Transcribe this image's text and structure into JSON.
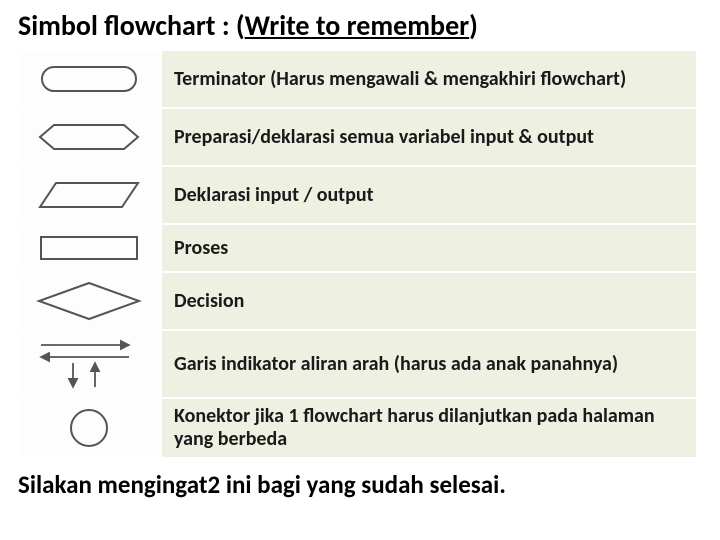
{
  "title_main": "Simbol flowchart : (",
  "title_underlined": "Write to remember",
  "title_close": ")",
  "rows": [
    {
      "desc": "Terminator (Harus mengawali & mengakhiri flowchart)"
    },
    {
      "desc": "Preparasi/deklarasi semua variabel input & output"
    },
    {
      "desc": "Deklarasi input / output"
    },
    {
      "desc": "Proses"
    },
    {
      "desc": "Decision"
    },
    {
      "desc": "Garis indikator aliran arah (harus ada anak panahnya)"
    },
    {
      "desc": "Konektor jika 1 flowchart harus dilanjutkan pada halaman yang berbeda"
    }
  ],
  "footer": "Silakan mengingat2 ini bagi yang sudah selesai."
}
